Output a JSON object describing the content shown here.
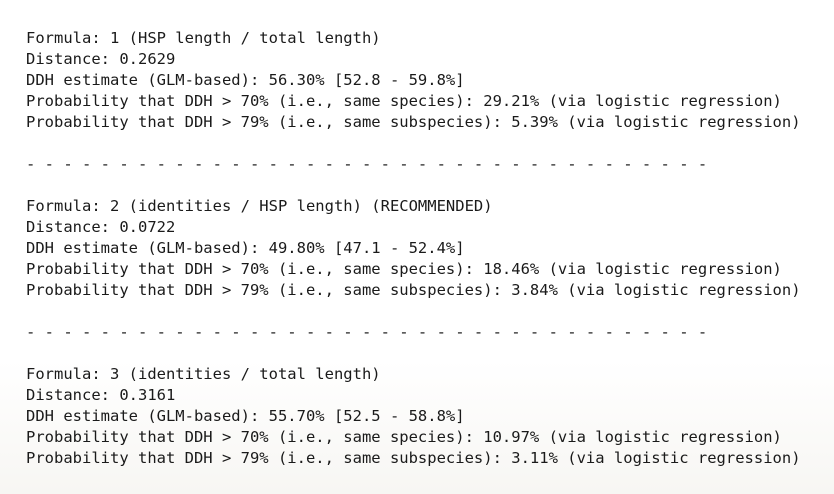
{
  "results": [
    {
      "formula": "Formula: 1 (HSP length / total length)",
      "distance": "Distance: 0.2629",
      "ddh_estimate": "DDH estimate (GLM-based): 56.30% [52.8 - 59.8%]",
      "prob_species": "Probability that DDH > 70% (i.e., same species): 29.21% (via logistic regression)",
      "prob_subspecies": "Probability that DDH > 79% (i.e., same subspecies): 5.39% (via logistic regression)"
    },
    {
      "formula": "Formula: 2 (identities / HSP length) (RECOMMENDED)",
      "distance": "Distance: 0.0722",
      "ddh_estimate": "DDH estimate (GLM-based): 49.80% [47.1 - 52.4%]",
      "prob_species": "Probability that DDH > 70% (i.e., same species): 18.46% (via logistic regression)",
      "prob_subspecies": "Probability that DDH > 79% (i.e., same subspecies): 3.84% (via logistic regression)"
    },
    {
      "formula": "Formula: 3 (identities / total length)",
      "distance": "Distance: 0.3161",
      "ddh_estimate": "DDH estimate (GLM-based): 55.70% [52.5 - 58.8%]",
      "prob_species": "Probability that DDH > 70% (i.e., same species): 10.97% (via logistic regression)",
      "prob_subspecies": "Probability that DDH > 79% (i.e., same subspecies): 3.11% (via logistic regression)"
    }
  ],
  "separator": "- - - - - - - - - - - - - - - - - - - - - - - - - - - - - - - - - - - - -"
}
